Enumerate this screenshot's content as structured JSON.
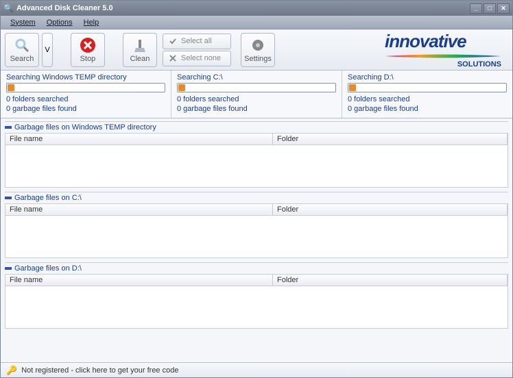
{
  "window": {
    "title": "Advanced Disk Cleaner 5.0"
  },
  "menu": {
    "system": "System",
    "options": "Options",
    "help": "Help"
  },
  "toolbar": {
    "search": "Search",
    "dropdown": "V",
    "stop": "Stop",
    "clean": "Clean",
    "select_all": "Select all",
    "select_none": "Select none",
    "settings": "Settings"
  },
  "brand": {
    "name": "innovative",
    "sub": "SOLUTIONS"
  },
  "progress": [
    {
      "title": "Searching Windows TEMP directory",
      "folders_searched": "0  folders searched",
      "garbage_found": "0  garbage files found"
    },
    {
      "title": "Searching C:\\",
      "folders_searched": "0  folders searched",
      "garbage_found": "0  garbage files found"
    },
    {
      "title": "Searching D:\\",
      "folders_searched": "0  folders searched",
      "garbage_found": "0  garbage files found"
    }
  ],
  "sections": [
    {
      "title": "Garbage files on Windows TEMP directory",
      "col_filename": "File name",
      "col_folder": "Folder"
    },
    {
      "title": "Garbage files on C:\\",
      "col_filename": "File name",
      "col_folder": "Folder"
    },
    {
      "title": "Garbage files on D:\\",
      "col_filename": "File name",
      "col_folder": "Folder"
    }
  ],
  "status": {
    "text": "Not registered - click here to get your free code"
  }
}
